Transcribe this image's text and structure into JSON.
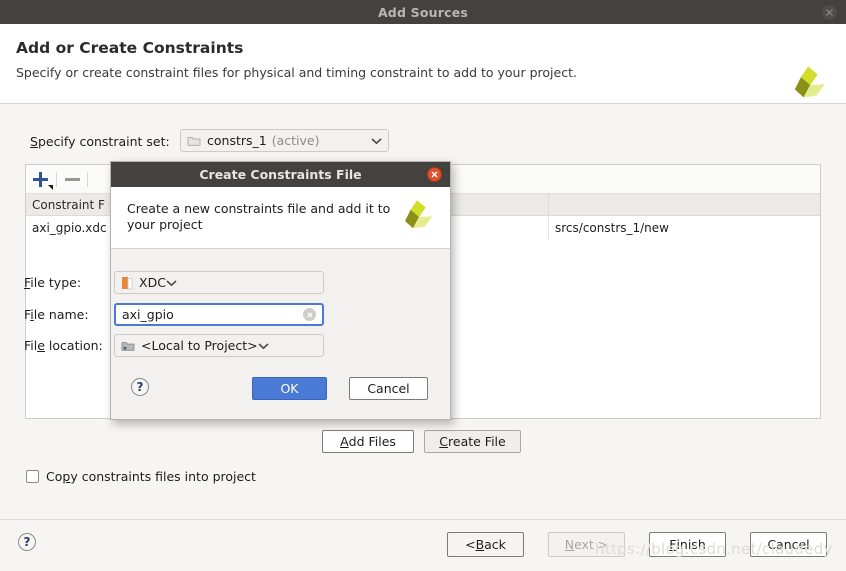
{
  "window": {
    "title": "Add Sources",
    "close_icon": "close-icon"
  },
  "header": {
    "title": "Add or Create Constraints",
    "subtitle": "Specify or create constraint files for physical and timing constraint to add to your project.",
    "logo_icon": "vivado-logo-icon"
  },
  "constraint_set": {
    "label_pre": "S",
    "label_rest": "pecify constraint set:",
    "folder_icon": "folder-icon",
    "value": "constrs_1",
    "suffix": "(active)",
    "caret_icon": "chevron-down-icon"
  },
  "toolbar": {
    "add_icon": "plus-icon",
    "remove_icon": "minus-icon"
  },
  "files_table": {
    "columns": [
      "Constraint F",
      "",
      ""
    ],
    "rows": [
      [
        "axi_gpio.xdc",
        "",
        "srcs/constrs_1/new"
      ]
    ]
  },
  "panel_buttons": {
    "add_files_pre": "A",
    "add_files_rest": "dd Files",
    "create_file_pre": "C",
    "create_file_rest": "reate File"
  },
  "copy_option": {
    "text_a": "Co",
    "text_mnem": "p",
    "text_b": "y constraints files into project",
    "checked": false
  },
  "footer": {
    "help_icon": "question-mark-icon",
    "help_label": "?",
    "back_pre": "< ",
    "back_mnem": "B",
    "back_rest": "ack",
    "next_mnem": "N",
    "next_rest": "ext >",
    "finish_mnem": "F",
    "finish_rest": "inish",
    "cancel": "Cancel",
    "watermark": "https://blog.csdn.net/claudedy"
  },
  "modal": {
    "title": "Create Constraints File",
    "close_icon": "close-icon",
    "description": "Create a new constraints file and add it to your project",
    "logo_icon": "vivado-logo-icon",
    "file_type": {
      "label_pre": "F",
      "label_mnem": "i",
      "label_rest": "le type:",
      "icon": "xdc-document-icon",
      "value": "XDC",
      "caret_icon": "chevron-down-icon"
    },
    "file_name": {
      "label_a": "F",
      "label_mnem": "i",
      "label_b": "le name:",
      "value": "axi_gpio",
      "placeholder": "",
      "clear_icon": "clear-circle-icon"
    },
    "file_location": {
      "label_a": "Fil",
      "label_mnem": "e",
      "label_b": " location:",
      "icon": "folder-icon",
      "value": "<Local to Project>",
      "caret_icon": "chevron-down-icon"
    },
    "help_icon": "question-mark-icon",
    "help_label": "?",
    "ok_label": "OK",
    "cancel_label": "Cancel",
    "accent_color": "#4a7ad6"
  },
  "colors": {
    "titlebar": "#43423e",
    "accent_blue": "#4a7ad6",
    "close_red": "#e0522c",
    "logo_green": "#c8d419",
    "logo_olive": "#8a8f17"
  }
}
